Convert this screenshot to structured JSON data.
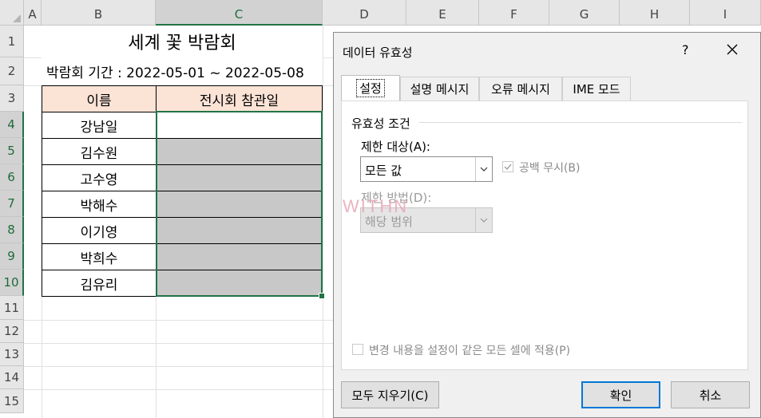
{
  "columns": [
    "A",
    "B",
    "C",
    "D",
    "E",
    "F",
    "G",
    "H",
    "I"
  ],
  "rows": [
    "1",
    "2",
    "3",
    "4",
    "5",
    "6",
    "7",
    "8",
    "9",
    "10",
    "11",
    "12",
    "13",
    "14",
    "15"
  ],
  "sheet": {
    "title": "세계 꽃 박람회",
    "period": "박람회 기간 : 2022-05-01 ~ 2022-05-08",
    "header_name": "이름",
    "header_date": "전시회 참관일",
    "names": [
      "강남일",
      "김수원",
      "고수영",
      "박해수",
      "이기영",
      "박희수",
      "김유리"
    ]
  },
  "dialog": {
    "title": "데이터 유효성",
    "help": "?",
    "tabs": [
      "설정",
      "설명 메시지",
      "오류 메시지",
      "IME 모드"
    ],
    "group_label": "유효성 조건",
    "allow_label": "제한 대상(A):",
    "allow_value": "모든 값",
    "ignore_blank": "공백 무시(B)",
    "data_label": "제한 방법(D):",
    "data_value": "해당 범위",
    "apply_all": "변경 내용을 설정이 같은 모든 셀에 적용(P)",
    "clear_all": "모두 지우기(C)",
    "ok": "확인",
    "cancel": "취소"
  },
  "watermark": "WITHN",
  "colors": {
    "selection": "#217346",
    "header_fill": "#fbe3d6",
    "gray_fill": "#c8c8c8",
    "default_button": "#0078d7"
  }
}
